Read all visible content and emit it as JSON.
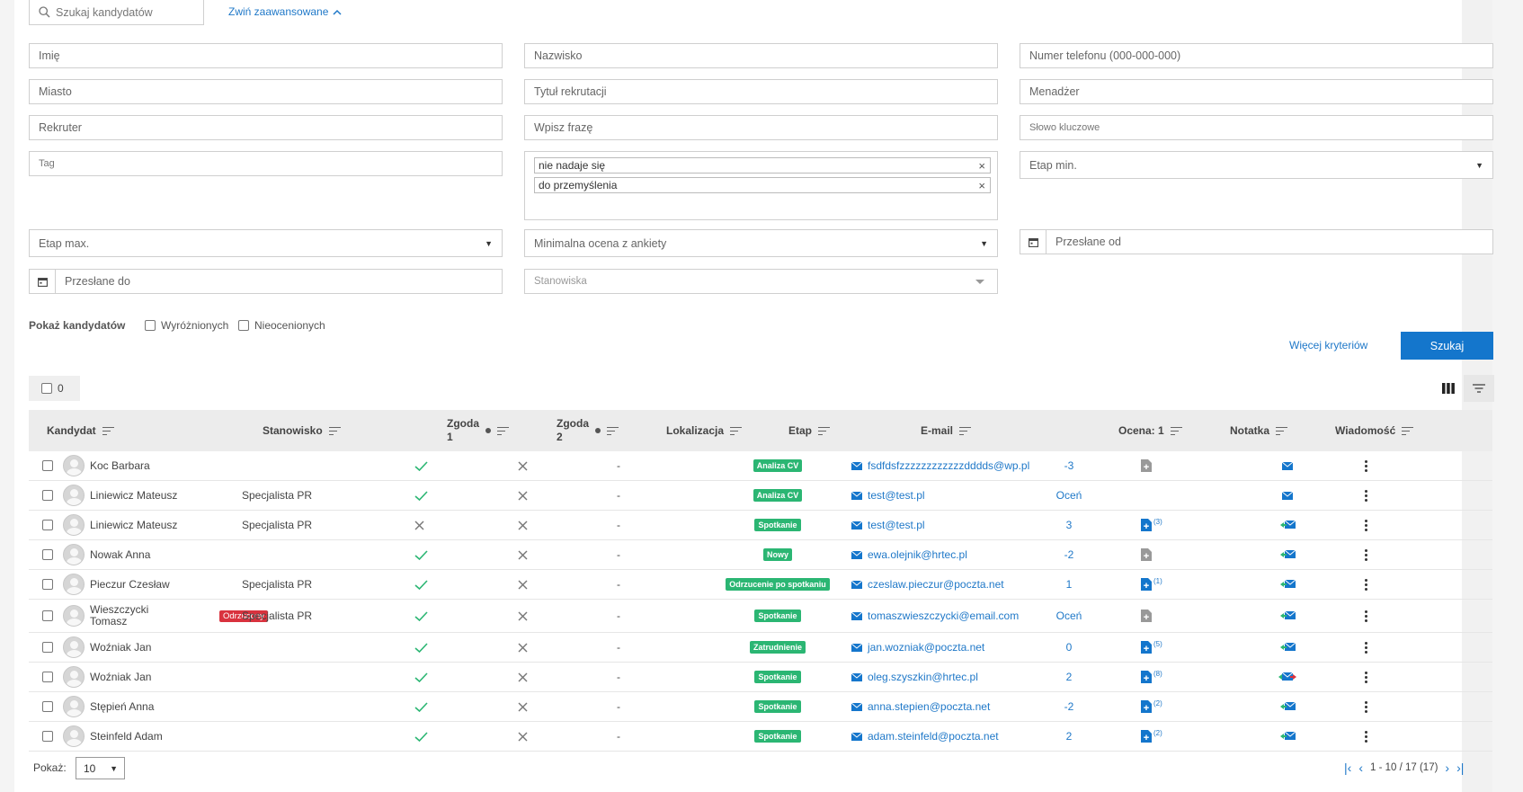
{
  "search": {
    "placeholder": "Szukaj kandydatów",
    "collapse_label": "Zwiń zaawansowane"
  },
  "filters": {
    "first_name": "Imię",
    "last_name": "Nazwisko",
    "phone": "Numer telefonu (000-000-000)",
    "city": "Miasto",
    "recruitment_title": "Tytuł rekrutacji",
    "manager": "Menadżer",
    "recruiter": "Rekruter",
    "phrase": "Wpisz frazę",
    "keywords": "Słowo kluczowe",
    "tag": "Tag",
    "selected_tags": [
      "nie nadaje się",
      "do przemyślenia"
    ],
    "stage_min": "Etap min.",
    "stage_max": "Etap max.",
    "min_survey_score": "Minimalna ocena z ankiety",
    "sent_from": "Przesłane od",
    "sent_to": "Przesłane do",
    "positions": "Stanowiska"
  },
  "show_candidates": {
    "label": "Pokaż kandydatów",
    "featured": "Wyróżnionych",
    "unrated": "Nieocenionych"
  },
  "more_criteria": "Więcej kryteriów",
  "search_button": "Szukaj",
  "selected_count": "0",
  "table": {
    "headers": {
      "candidate": "Kandydat",
      "position": "Stanowisko",
      "consent1_a": "Zgoda",
      "consent1_b": "1",
      "consent2_a": "Zgoda",
      "consent2_b": "2",
      "location": "Lokalizacja",
      "stage": "Etap",
      "email": "E-mail",
      "score": "Ocena: 1",
      "note": "Notatka",
      "message": "Wiadomość"
    },
    "rows": [
      {
        "name": "Koc Barbara",
        "position": "",
        "consent1": "yes",
        "consent2": "no",
        "location": "-",
        "stage": "Analiza CV",
        "email": "fsdfdsfzzzzzzzzzzzzdddds@wp.pl",
        "score": "-3",
        "note_type": "empty",
        "note_count": "",
        "message": "single"
      },
      {
        "name": "Liniewicz Mateusz",
        "position": "Specjalista PR",
        "consent1": "yes",
        "consent2": "no",
        "location": "-",
        "stage": "Analiza CV",
        "email": "test@test.pl",
        "score": "Oceń",
        "note_type": "none",
        "note_count": "",
        "message": "single"
      },
      {
        "name": "Liniewicz Mateusz",
        "position": "Specjalista PR",
        "consent1": "no",
        "consent2": "no",
        "location": "-",
        "stage": "Spotkanie",
        "email": "test@test.pl",
        "score": "3",
        "note_type": "filled",
        "note_count": "(3)",
        "message": "thread"
      },
      {
        "name": "Nowak Anna",
        "position": "",
        "consent1": "yes",
        "consent2": "no",
        "location": "-",
        "stage": "Nowy",
        "email": "ewa.olejnik@hrtec.pl",
        "score": "-2",
        "note_type": "empty",
        "note_count": "",
        "message": "thread"
      },
      {
        "name": "Pieczur Czesław",
        "position": "Specjalista PR",
        "consent1": "yes",
        "consent2": "no",
        "location": "-",
        "stage": "Odrzucenie po spotkaniu",
        "email": "czeslaw.pieczur@poczta.net",
        "score": "1",
        "note_type": "filled",
        "note_count": "(1)",
        "message": "thread"
      },
      {
        "name": "Wieszczycki Tomasz",
        "name_line1": "Wieszczycki",
        "name_line2": "Tomasz",
        "rejected": "Odrzucony",
        "position": "Specjalista PR",
        "consent1": "yes",
        "consent2": "no",
        "location": "-",
        "stage": "Spotkanie",
        "email": "tomaszwieszczycki@email.com",
        "score": "Oceń",
        "note_type": "empty",
        "note_count": "",
        "message": "thread"
      },
      {
        "name": "Woźniak Jan",
        "position": "",
        "consent1": "yes",
        "consent2": "no",
        "location": "-",
        "stage": "Zatrudnienie",
        "email": "jan.wozniak@poczta.net",
        "score": "0",
        "note_type": "filled",
        "note_count": "(5)",
        "message": "thread"
      },
      {
        "name": "Woźniak Jan",
        "position": "",
        "consent1": "yes",
        "consent2": "no",
        "location": "-",
        "stage": "Spotkanie",
        "email": "oleg.szyszkin@hrtec.pl",
        "score": "2",
        "note_type": "filled",
        "note_count": "(8)",
        "message": "thread-red"
      },
      {
        "name": "Stępień Anna",
        "position": "",
        "consent1": "yes",
        "consent2": "no",
        "location": "-",
        "stage": "Spotkanie",
        "email": "anna.stepien@poczta.net",
        "score": "-2",
        "note_type": "filled",
        "note_count": "(2)",
        "message": "thread"
      },
      {
        "name": "Steinfeld Adam",
        "position": "",
        "consent1": "yes",
        "consent2": "no",
        "location": "-",
        "stage": "Spotkanie",
        "email": "adam.steinfeld@poczta.net",
        "score": "2",
        "note_type": "filled",
        "note_count": "(2)",
        "message": "thread"
      }
    ]
  },
  "footer": {
    "show_label": "Pokaż:",
    "per_page": "10",
    "range": "1 - 10 / 17 (17)"
  },
  "colors": {
    "accent": "#1476cc",
    "link": "#1f78c8",
    "stage": "#2bb673",
    "rejected": "#d9323e",
    "check": "#2bb673"
  }
}
